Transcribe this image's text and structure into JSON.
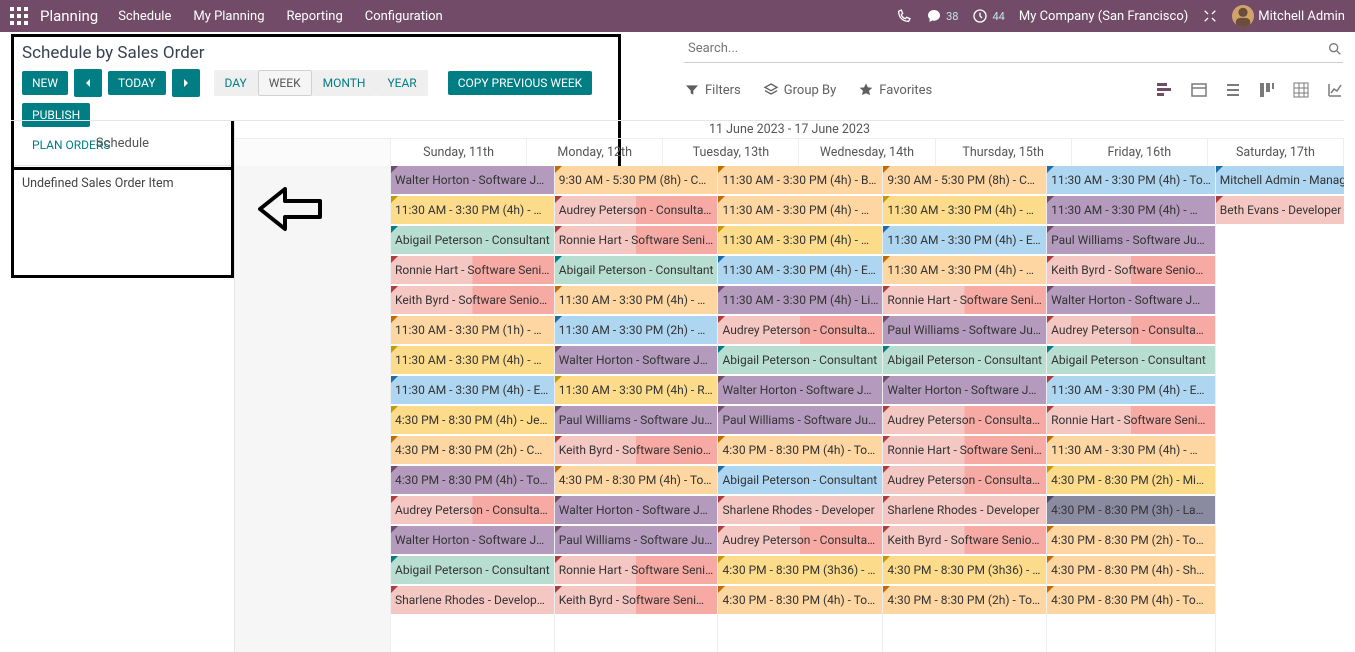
{
  "topbar": {
    "app": "Planning",
    "menu": [
      "Schedule",
      "My Planning",
      "Reporting",
      "Configuration"
    ],
    "msg_count": "38",
    "clock_count": "44",
    "company": "My Company (San Francisco)",
    "user": "Mitchell Admin"
  },
  "toolbar": {
    "title": "Schedule by Sales Order",
    "new": "NEW",
    "today": "TODAY",
    "seg": [
      "DAY",
      "WEEK",
      "MONTH",
      "YEAR"
    ],
    "seg_active": "WEEK",
    "copy": "COPY PREVIOUS WEEK",
    "publish": "PUBLISH",
    "plan": "PLAN ORDERS"
  },
  "search": {
    "placeholder": "Search..."
  },
  "filter": {
    "filters": "Filters",
    "groupby": "Group By",
    "favorites": "Favorites"
  },
  "side": {
    "head": "Schedule",
    "row": "Undefined Sales Order Item"
  },
  "range": "11 June 2023 - 17 June 2023",
  "days": [
    "Sunday, 11th",
    "Monday, 12th",
    "Tuesday, 13th",
    "Wednesday, 14th",
    "Thursday, 15th",
    "Friday, 16th",
    "Saturday, 17th"
  ],
  "cols": {
    "sun": [],
    "mon": [
      {
        "t": "Walter Horton - Software J…",
        "bg": "#b49bbd",
        "cn": "#714B67"
      },
      {
        "t": "11:30 AM - 3:30 PM (4h) - …",
        "bg": "#fcdc8b",
        "cn": "#c49a00"
      },
      {
        "t": "Abigail Peterson - Consultant",
        "bg": "#b7ded1",
        "cn": "#017e84"
      },
      {
        "t": "Ronnie Hart - Software Seni…",
        "bg": "#f4c7c3",
        "bg2": "#f7a9a3",
        "h": true,
        "cn": "#b23b3b"
      },
      {
        "t": "Keith Byrd - Software Senio…",
        "bg": "#f4c7c3",
        "bg2": "#f7a9a3",
        "h": true,
        "cn": "#b23b3b"
      },
      {
        "t": "11:30 AM - 3:30 PM (1h) - …",
        "bg": "#fdd6a1",
        "cn": "#c66a00"
      },
      {
        "t": "11:30 AM - 3:30 PM (4h) - …",
        "bg": "#fcdc8b",
        "cn": "#c49a00"
      },
      {
        "t": "11:30 AM - 3:30 PM (4h) - E…",
        "bg": "#aed6f1",
        "cn": "#1b6ea8"
      },
      {
        "t": "4:30 PM - 8:30 PM (4h) - Je…",
        "bg": "#fcdc8b",
        "cn": "#c49a00"
      },
      {
        "t": "4:30 PM - 8:30 PM (2h) - C…",
        "bg": "#fdd6a1",
        "cn": "#c66a00"
      },
      {
        "t": "4:30 PM - 8:30 PM (4h) - To…",
        "bg": "#b49bbd",
        "cn": "#714B67"
      },
      {
        "t": "Audrey Peterson - Consulta…",
        "bg": "#f4c7c3",
        "bg2": "#f7a9a3",
        "h": true,
        "cn": "#b23b3b"
      },
      {
        "t": "Walter Horton - Software J…",
        "bg": "#b49bbd",
        "cn": "#714B67"
      },
      {
        "t": "Abigail Peterson - Consultant",
        "bg": "#b7ded1",
        "cn": "#017e84"
      },
      {
        "t": "Sharlene Rhodes - Develop…",
        "bg": "#f4c7c3",
        "cn": "#b23b3b"
      }
    ],
    "tue": [
      {
        "t": "9:30 AM - 5:30 PM (8h) - C…",
        "bg": "#fdd6a1",
        "cn": "#c66a00"
      },
      {
        "t": "Audrey Peterson - Consulta…",
        "bg": "#f4c7c3",
        "bg2": "#f7a9a3",
        "h": true,
        "cn": "#b23b3b"
      },
      {
        "t": "Ronnie Hart - Software Seni…",
        "bg": "#f4c7c3",
        "bg2": "#f7a9a3",
        "h": true,
        "cn": "#b23b3b"
      },
      {
        "t": "Abigail Peterson - Consultant",
        "bg": "#b7ded1",
        "cn": "#017e84"
      },
      {
        "t": "11:30 AM - 3:30 PM (4h) - …",
        "bg": "#fdd6a1",
        "cn": "#c66a00"
      },
      {
        "t": "11:30 AM - 3:30 PM (2h) - …",
        "bg": "#aed6f1",
        "cn": "#1b6ea8"
      },
      {
        "t": "Walter Horton - Software J…",
        "bg": "#b49bbd",
        "cn": "#714B67"
      },
      {
        "t": "11:30 AM - 3:30 PM (4h) - R…",
        "bg": "#fcdc8b",
        "cn": "#c49a00"
      },
      {
        "t": "Paul Williams - Software Ju…",
        "bg": "#b49bbd",
        "cn": "#714B67"
      },
      {
        "t": "Keith Byrd - Software Senio…",
        "bg": "#f4c7c3",
        "bg2": "#f7a9a3",
        "h": true,
        "cn": "#b23b3b"
      },
      {
        "t": "4:30 PM - 8:30 PM (4h) - To…",
        "bg": "#fdd6a1",
        "cn": "#c66a00"
      },
      {
        "t": "Walter Horton - Software J…",
        "bg": "#b49bbd",
        "cn": "#714B67"
      },
      {
        "t": "Paul Williams - Software Ju…",
        "bg": "#b49bbd",
        "cn": "#714B67"
      },
      {
        "t": "Ronnie Hart - Software Seni…",
        "bg": "#f4c7c3",
        "bg2": "#f7a9a3",
        "h": true,
        "cn": "#b23b3b"
      },
      {
        "t": "Keith Byrd - Software Seni…",
        "bg": "#f4c7c3",
        "bg2": "#f7a9a3",
        "h": true,
        "cn": "#b23b3b"
      }
    ],
    "wed": [
      {
        "t": "11:30 AM - 3:30 PM (4h) - B…",
        "bg": "#fdd6a1",
        "cn": "#c66a00"
      },
      {
        "t": "11:30 AM - 3:30 PM (4h) - …",
        "bg": "#fdd6a1",
        "cn": "#c66a00"
      },
      {
        "t": "11:30 AM - 3:30 PM (4h) - …",
        "bg": "#fcdc8b",
        "cn": "#c49a00"
      },
      {
        "t": "11:30 AM - 3:30 PM (4h) - E…",
        "bg": "#aed6f1",
        "cn": "#1b6ea8"
      },
      {
        "t": "11:30 AM - 3:30 PM (4h) - Li…",
        "bg": "#b49bbd",
        "cn": "#714B67"
      },
      {
        "t": "Audrey Peterson - Consulta…",
        "bg": "#f4c7c3",
        "bg2": "#f7a9a3",
        "h": true,
        "cn": "#b23b3b"
      },
      {
        "t": "Abigail Peterson - Consultant",
        "bg": "#b7ded1",
        "cn": "#017e84"
      },
      {
        "t": "Walter Horton - Software J…",
        "bg": "#b49bbd",
        "cn": "#714B67"
      },
      {
        "t": "Paul Williams - Software Ju…",
        "bg": "#b49bbd",
        "cn": "#714B67"
      },
      {
        "t": "4:30 PM - 8:30 PM (4h) - To…",
        "bg": "#fdd6a1",
        "cn": "#c66a00"
      },
      {
        "t": "Abigail Peterson - Consultant",
        "bg": "#aed6f1",
        "cn": "#1b6ea8"
      },
      {
        "t": "Sharlene Rhodes - Developer",
        "bg": "#f4c7c3",
        "cn": "#b23b3b"
      },
      {
        "t": "Audrey Peterson - Consulta…",
        "bg": "#f4c7c3",
        "bg2": "#f7a9a3",
        "h": true,
        "cn": "#b23b3b"
      },
      {
        "t": "4:30 PM - 8:30 PM (3h36) - …",
        "bg": "#fcdc8b",
        "cn": "#c49a00"
      },
      {
        "t": "4:30 PM - 8:30 PM (4h) - To…",
        "bg": "#fdd6a1",
        "cn": "#c66a00"
      }
    ],
    "thu": [
      {
        "t": "9:30 AM - 5:30 PM (8h) - C…",
        "bg": "#fdd6a1",
        "cn": "#c66a00"
      },
      {
        "t": "11:30 AM - 3:30 PM (4h) - …",
        "bg": "#fcdc8b",
        "cn": "#c49a00"
      },
      {
        "t": "11:30 AM - 3:30 PM (4h) - E…",
        "bg": "#aed6f1",
        "cn": "#1b6ea8"
      },
      {
        "t": "11:30 AM - 3:30 PM (4h) - …",
        "bg": "#fdd6a1",
        "cn": "#c66a00"
      },
      {
        "t": "Ronnie Hart - Software Seni…",
        "bg": "#f4c7c3",
        "bg2": "#f7a9a3",
        "h": true,
        "cn": "#b23b3b"
      },
      {
        "t": "Paul Williams - Software Ju…",
        "bg": "#b49bbd",
        "cn": "#714B67"
      },
      {
        "t": "Abigail Peterson - Consultant",
        "bg": "#b7ded1",
        "cn": "#017e84"
      },
      {
        "t": "Walter Horton - Software J…",
        "bg": "#b49bbd",
        "cn": "#714B67"
      },
      {
        "t": "Audrey Peterson - Consulta…",
        "bg": "#f4c7c3",
        "bg2": "#f7a9a3",
        "h": true,
        "cn": "#b23b3b"
      },
      {
        "t": "Ronnie Hart - Software Seni…",
        "bg": "#f4c7c3",
        "bg2": "#f7a9a3",
        "h": true,
        "cn": "#b23b3b"
      },
      {
        "t": "Audrey Peterson - Consulta…",
        "bg": "#f4c7c3",
        "bg2": "#f7a9a3",
        "h": true,
        "cn": "#b23b3b"
      },
      {
        "t": "Sharlene Rhodes - Developer",
        "bg": "#f4c7c3",
        "cn": "#b23b3b"
      },
      {
        "t": "Keith Byrd - Software Senio…",
        "bg": "#f4c7c3",
        "bg2": "#f7a9a3",
        "h": true,
        "cn": "#b23b3b"
      },
      {
        "t": "4:30 PM - 8:30 PM (3h36) - …",
        "bg": "#fcdc8b",
        "cn": "#c49a00"
      },
      {
        "t": "4:30 PM - 8:30 PM (2h) - To…",
        "bg": "#fdd6a1",
        "cn": "#c66a00"
      }
    ],
    "fri": [
      {
        "t": "11:30 AM - 3:30 PM (4h) - To…",
        "bg": "#aed6f1",
        "cn": "#1b6ea8"
      },
      {
        "t": "11:30 AM - 3:30 PM (4h) - …",
        "bg": "#b49bbd",
        "cn": "#714B67"
      },
      {
        "t": "Paul Williams - Software Ju…",
        "bg": "#b49bbd",
        "cn": "#714B67"
      },
      {
        "t": "Keith Byrd - Software Senio…",
        "bg": "#f4c7c3",
        "bg2": "#f7a9a3",
        "h": true,
        "cn": "#b23b3b"
      },
      {
        "t": "Walter Horton - Software J…",
        "bg": "#b49bbd",
        "cn": "#714B67"
      },
      {
        "t": "Audrey Peterson - Consulta…",
        "bg": "#f4c7c3",
        "bg2": "#f7a9a3",
        "h": true,
        "cn": "#b23b3b"
      },
      {
        "t": "Abigail Peterson - Consultant",
        "bg": "#b7ded1",
        "cn": "#017e84"
      },
      {
        "t": "11:30 AM - 3:30 PM (4h) - E…",
        "bg": "#aed6f1",
        "cn": "#b23b3b"
      },
      {
        "t": "Ronnie Hart - Software Seni…",
        "bg": "#f4c7c3",
        "bg2": "#f7a9a3",
        "h": true,
        "cn": "#b23b3b"
      },
      {
        "t": "11:30 AM - 3:30 PM (4h) - …",
        "bg": "#fdd6a1",
        "cn": "#c66a00"
      },
      {
        "t": "4:30 PM - 8:30 PM (2h) - Mi…",
        "bg": "#fcdc8b",
        "cn": "#c49a00"
      },
      {
        "t": "4:30 PM - 8:30 PM (3h) - La…",
        "bg": "#8a8aa0",
        "cn": "#4a4a6a"
      },
      {
        "t": "4:30 PM - 8:30 PM (2h) - To…",
        "bg": "#fdd6a1",
        "cn": "#c66a00"
      },
      {
        "t": "4:30 PM - 8:30 PM (4h) - Sh…",
        "bg": "#fdd6a1",
        "cn": "#c66a00"
      },
      {
        "t": "4:30 PM - 8:30 PM (4h) - To…",
        "bg": "#fdd6a1",
        "cn": "#c66a00"
      }
    ],
    "sat": [
      {
        "t": "Mitchell Admin - Managem…",
        "bg": "#aed6f1",
        "cn": "#1b6ea8"
      },
      {
        "t": "Beth Evans - Developer - In…",
        "bg": "#f4c7c3",
        "cn": "#b23b3b"
      }
    ]
  }
}
